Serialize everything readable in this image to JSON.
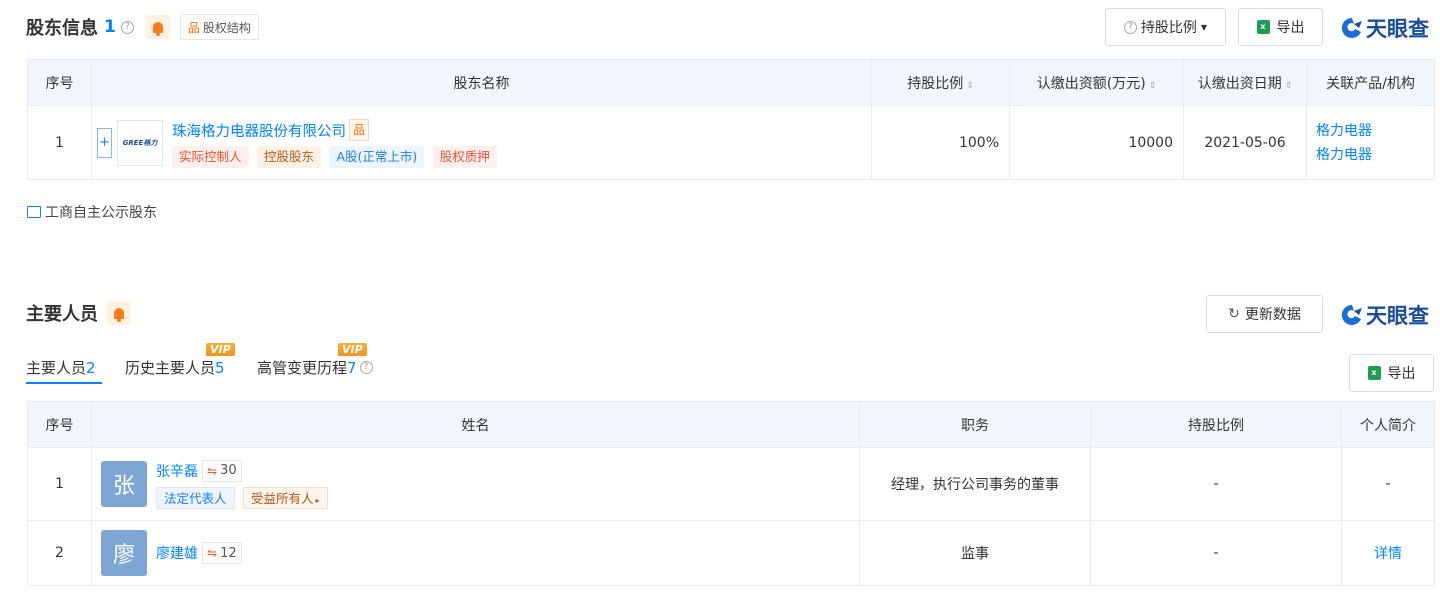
{
  "shareholders": {
    "title": "股东信息",
    "count": "1",
    "equity_structure_label": "股权结构",
    "ratio_dropdown_label": "持股比例",
    "export_label": "导出",
    "brand": "天眼查",
    "columns": [
      "序号",
      "股东名称",
      "持股比例",
      "认缴出资额(万元)",
      "认缴出资日期",
      "关联产品/机构"
    ],
    "rows": [
      {
        "index": "1",
        "logo_text": "GREE格力",
        "name": "珠海格力电器股份有限公司",
        "tags": [
          "实际控制人",
          "控股股东",
          "A股(正常上市)",
          "股权质押"
        ],
        "ratio": "100%",
        "amount": "10000",
        "date": "2021-05-06",
        "related": [
          "格力电器",
          "格力电器"
        ]
      }
    ],
    "public_link": "工商自主公示股东"
  },
  "personnel": {
    "title": "主要人员",
    "refresh_label": "更新数据",
    "brand": "天眼查",
    "export_label": "导出",
    "tabs": [
      {
        "label": "主要人员",
        "count": "2"
      },
      {
        "label": "历史主要人员",
        "count": "5",
        "vip": "VIP"
      },
      {
        "label": "高管变更历程",
        "count": "7",
        "vip": "VIP"
      }
    ],
    "columns": [
      "序号",
      "姓名",
      "职务",
      "持股比例",
      "个人简介"
    ],
    "rows": [
      {
        "index": "1",
        "avatar": "张",
        "name": "张辛磊",
        "relations": "30",
        "tags": [
          "法定代表人",
          "受益所有人"
        ],
        "position": "经理，执行公司事务的董事",
        "ratio": "-",
        "bio": "-"
      },
      {
        "index": "2",
        "avatar": "廖",
        "name": "廖建雄",
        "relations": "12",
        "tags": [],
        "position": "监事",
        "ratio": "-",
        "bio": "详情"
      }
    ]
  }
}
